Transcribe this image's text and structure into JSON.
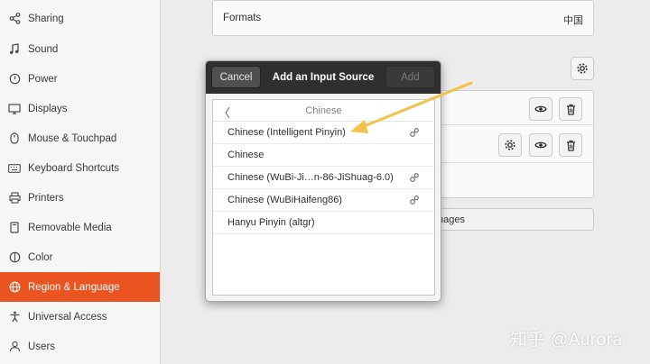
{
  "sidebar": {
    "items": [
      {
        "label": "Sharing",
        "icon": "share-icon",
        "active": false
      },
      {
        "label": "Sound",
        "icon": "music-note-icon",
        "active": false
      },
      {
        "label": "Power",
        "icon": "power-icon",
        "active": false
      },
      {
        "label": "Displays",
        "icon": "display-icon",
        "active": false
      },
      {
        "label": "Mouse & Touchpad",
        "icon": "mouse-icon",
        "active": false
      },
      {
        "label": "Keyboard Shortcuts",
        "icon": "keyboard-icon",
        "active": false
      },
      {
        "label": "Printers",
        "icon": "printer-icon",
        "active": false
      },
      {
        "label": "Removable Media",
        "icon": "removable-media-icon",
        "active": false
      },
      {
        "label": "Color",
        "icon": "color-icon",
        "active": false
      },
      {
        "label": "Region & Language",
        "icon": "globe-icon",
        "active": true
      },
      {
        "label": "Universal Access",
        "icon": "accessibility-icon",
        "active": false
      },
      {
        "label": "Users",
        "icon": "users-icon",
        "active": false
      }
    ]
  },
  "main": {
    "formats_label": "Formats",
    "formats_value": "中国",
    "manage_languages_partial": "uages"
  },
  "dialog": {
    "cancel_label": "Cancel",
    "title": "Add an Input Source",
    "add_label": "Add",
    "list_header": "Chinese",
    "back_glyph": "〈",
    "items": [
      {
        "label": "Chinese (Intelligent Pinyin)",
        "has_prefs": true
      },
      {
        "label": "Chinese",
        "has_prefs": false
      },
      {
        "label": "Chinese (WuBi-Ji…n-86-JiShuag-6.0)",
        "has_prefs": true
      },
      {
        "label": "Chinese (WuBiHaifeng86)",
        "has_prefs": true
      },
      {
        "label": "Hanyu Pinyin (altgr)",
        "has_prefs": false
      }
    ]
  },
  "watermark": "知乎 @Aurora",
  "colors": {
    "accent": "#e95420",
    "arrow": "#f2c24a",
    "header_bg": "#2f2f2f"
  }
}
